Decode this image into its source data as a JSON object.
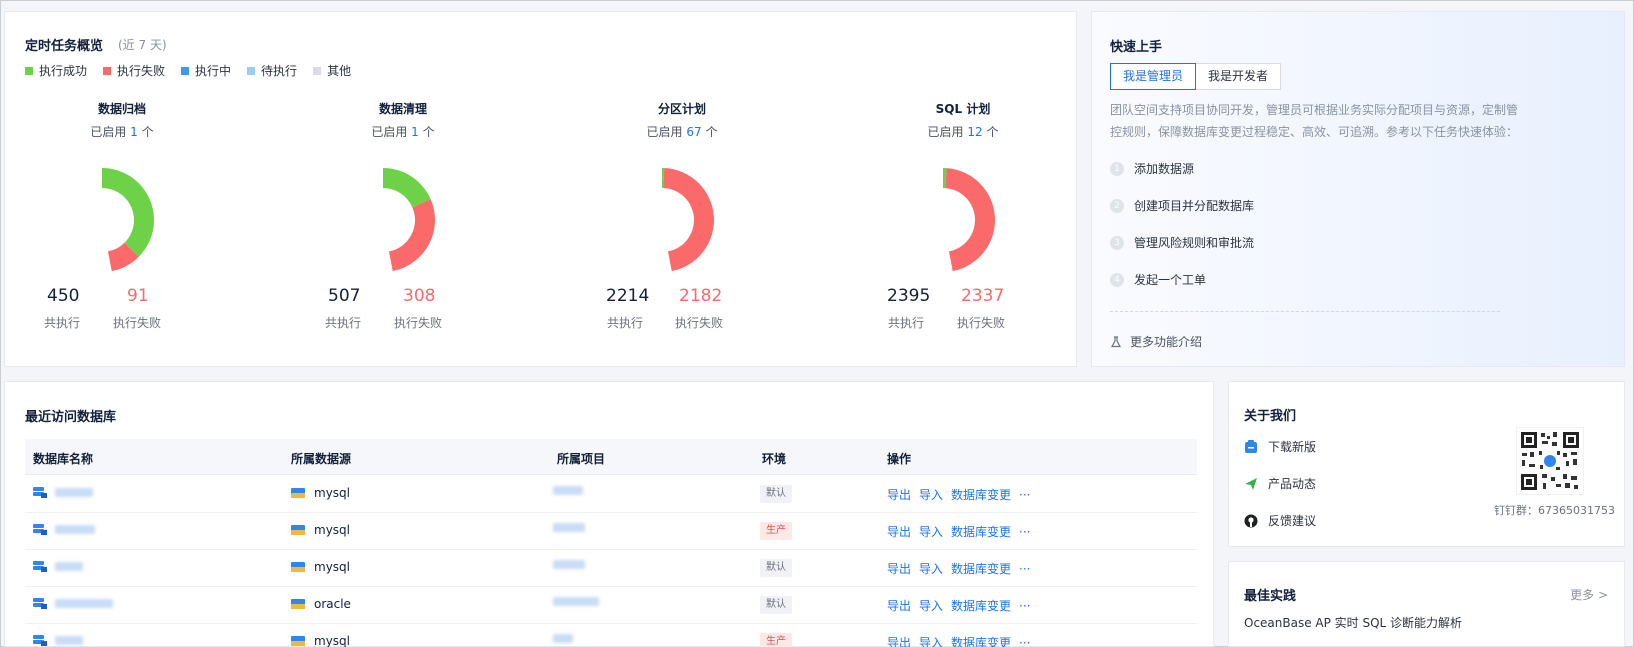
{
  "overview": {
    "title": "定时任务概览",
    "subtitle": "(近 7 天)",
    "legend": [
      {
        "label": "执行成功",
        "color": "#6ed248"
      },
      {
        "label": "执行失败",
        "color": "#fa6a6a"
      },
      {
        "label": "执行中",
        "color": "#3a9bf0"
      },
      {
        "label": "待执行",
        "color": "#99cdf6"
      },
      {
        "label": "其他",
        "color": "#d9dce2"
      }
    ],
    "stats": [
      {
        "name": "数据归档",
        "enabled_prefix": "已启用",
        "enabled_count": "1",
        "enabled_unit": "个",
        "total": "450",
        "total_label": "共执行",
        "failed": "91",
        "failed_label": "执行失败",
        "success": 359,
        "fail": 91
      },
      {
        "name": "数据清理",
        "enabled_prefix": "已启用",
        "enabled_count": "1",
        "enabled_unit": "个",
        "total": "507",
        "total_label": "共执行",
        "failed": "308",
        "failed_label": "执行失败",
        "success": 199,
        "fail": 308
      },
      {
        "name": "分区计划",
        "enabled_prefix": "已启用",
        "enabled_count": "67",
        "enabled_unit": "个",
        "total": "2214",
        "total_label": "共执行",
        "failed": "2182",
        "failed_label": "执行失败",
        "success": 32,
        "fail": 2182
      },
      {
        "name": "SQL 计划",
        "enabled_prefix": "已启用",
        "enabled_count": "12",
        "enabled_unit": "个",
        "total": "2395",
        "total_label": "共执行",
        "failed": "2337",
        "failed_label": "执行失败",
        "success": 58,
        "fail": 2337
      }
    ]
  },
  "quickstart": {
    "title": "快速上手",
    "tabs": [
      "我是管理员",
      "我是开发者"
    ],
    "active_tab": 0,
    "description": "团队空间支持项目协同开发，管理员可根据业务实际分配项目与资源，定制管控规则，保障数据库变更过程稳定、高效、可追溯。参考以下任务快速体验：",
    "steps": [
      {
        "num": "1",
        "label": "添加数据源"
      },
      {
        "num": "2",
        "label": "创建项目并分配数据库"
      },
      {
        "num": "3",
        "label": "管理风险规则和审批流"
      },
      {
        "num": "4",
        "label": "发起一个工单"
      }
    ],
    "more_label": "更多功能介绍"
  },
  "recent": {
    "title": "最近访问数据库",
    "columns": [
      "数据库名称",
      "所属数据源",
      "所属项目",
      "环境",
      "操作"
    ],
    "rows": [
      {
        "datasource": "mysql",
        "env": "默认",
        "env_type": "def"
      },
      {
        "datasource": "mysql",
        "env": "生产",
        "env_type": "prod"
      },
      {
        "datasource": "mysql",
        "env": "默认",
        "env_type": "def"
      },
      {
        "datasource": "oracle",
        "env": "默认",
        "env_type": "def"
      },
      {
        "datasource": "mysql",
        "env": "生产",
        "env_type": "prod"
      }
    ],
    "ops": {
      "export": "导出",
      "import": "导入",
      "change": "数据库变更",
      "more": "···"
    }
  },
  "about": {
    "title": "关于我们",
    "links": [
      {
        "label": "下载新版",
        "icon": "download-icon"
      },
      {
        "label": "产品动态",
        "icon": "send-icon"
      },
      {
        "label": "反馈建议",
        "icon": "github-icon"
      }
    ],
    "dingtalk": "钉钉群：67365031753"
  },
  "best": {
    "title": "最佳实践",
    "more": "更多 >",
    "article": "OceanBase AP 实时 SQL 诊断能力解析"
  }
}
